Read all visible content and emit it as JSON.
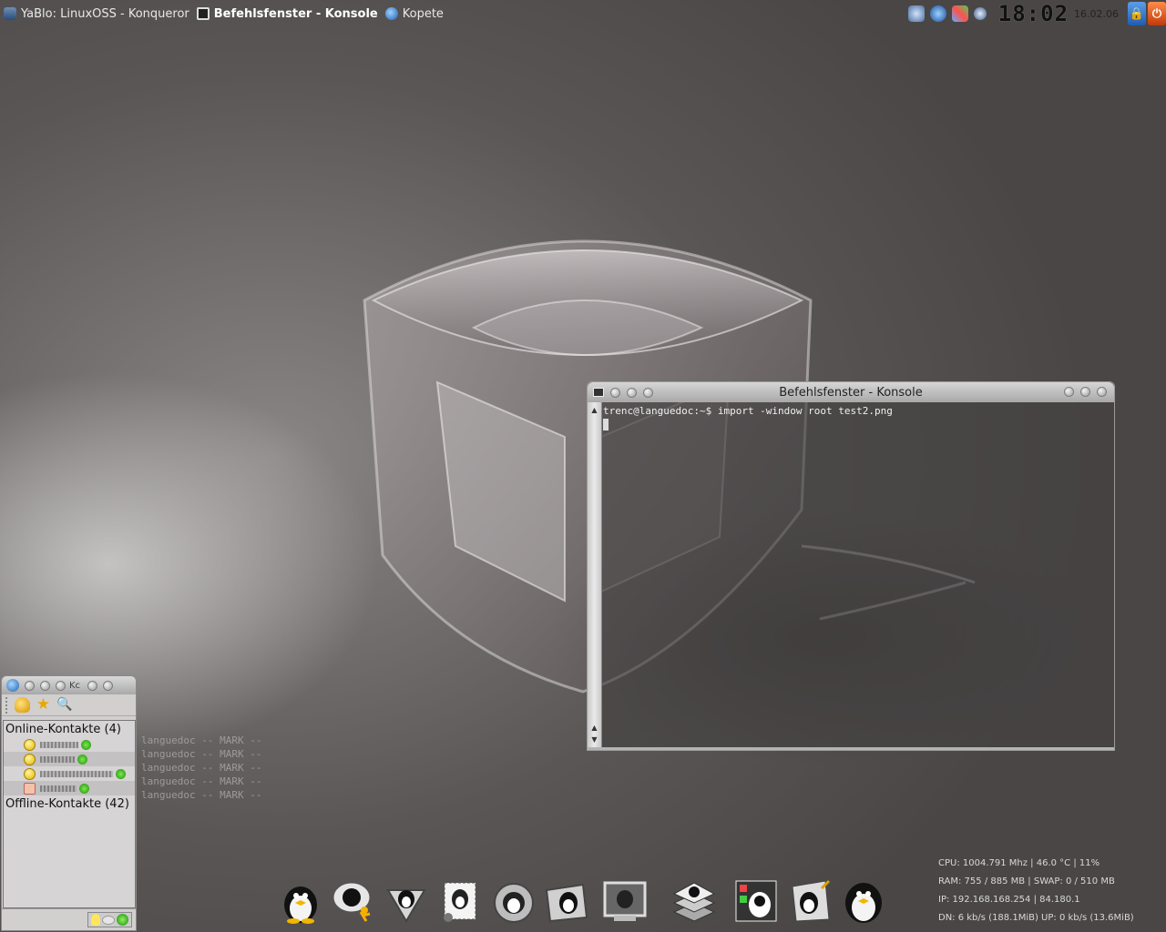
{
  "taskbar": {
    "tasks": [
      {
        "label": "YaBlo: LinuxOSS - Konqueror"
      },
      {
        "label": "Befehlsfenster - Konsole"
      },
      {
        "label": "Kopete"
      }
    ]
  },
  "tray": {
    "clock": "18:02",
    "date": "16.02.06",
    "icons": [
      "settings-icon",
      "network-globe-icon",
      "color-picker-icon",
      "volume-icon"
    ]
  },
  "konsole": {
    "title": "Befehlsfenster - Konsole",
    "prompt_line": "trenc@languedoc:~$ import -window root test2.png"
  },
  "kopete": {
    "title": "Kc",
    "online_group": "Online-Kontakte (4)",
    "offline_group": "Offline-Kontakte (42)"
  },
  "marks": [
    "languedoc -- MARK --",
    "languedoc -- MARK --",
    "languedoc -- MARK --",
    "languedoc -- MARK --",
    "languedoc -- MARK --"
  ],
  "sysinfo": {
    "cpu": "CPU:  1004.791 Mhz  |  46.0 °C  |  11%",
    "ram": "RAM:  755 / 885 MB  | SWAP: 0 / 510 MB",
    "ip": "IP:      192.168.168.254  | 84.180.1",
    "net": "DN: 6 kb/s  (188.1MiB) UP: 0 kb/s   (13.6MiB)"
  },
  "dock": {
    "items": [
      "penguin-icon",
      "chat-runner-icon",
      "download-penguin-icon",
      "mail-stamp-icon",
      "penguin-cd-icon",
      "penguin-folder-icon",
      "penguin-monitor-icon",
      "penguin-stack-icon",
      "penguin-control-panel-icon",
      "penguin-writer-icon",
      "penguin-ball-icon"
    ]
  },
  "colors": {
    "panel_text": "#e8e8e8",
    "terminal_text": "#f0f0f0",
    "titlebar": "#c0c0c0"
  }
}
